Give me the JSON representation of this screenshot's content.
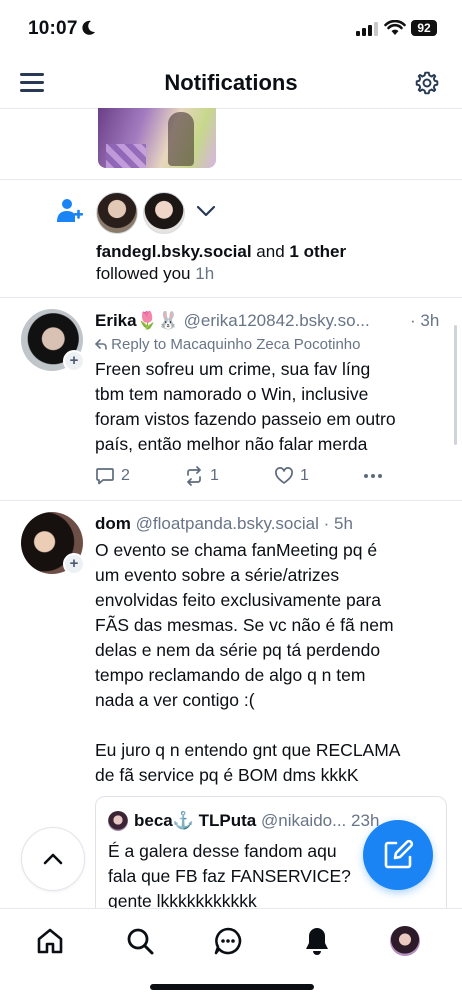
{
  "status_bar": {
    "time": "10:07",
    "battery": "92"
  },
  "header": {
    "title": "Notifications"
  },
  "follow_notification": {
    "handle": "fandegl.bsky.social",
    "connector": " and ",
    "others": "1 other",
    "action": "followed you",
    "time": "1h"
  },
  "posts": [
    {
      "display_name": "Erika🌷🐰",
      "handle": "@erika120842.bsky.so...",
      "time": "· 3h",
      "reply_to": "Reply to Macaquinho Zeca Pocotinho",
      "text": "Freen sofreu um crime, sua fav líng\ntbm tem namorado o Win, inclusive\nforam vistos fazendo passeio em outro\npaís, então melhor não falar merda",
      "reply_count": "2",
      "repost_count": "1",
      "like_count": "1"
    },
    {
      "display_name": "dom",
      "handle": "@floatpanda.bsky.social",
      "time": "· 5h",
      "text": "O evento se chama fanMeeting pq é\num evento sobre a série/atrizes\nenvolvidas feito exclusivamente para\nFÃS das mesmas. Se vc não é fã nem\ndelas e nem da série pq tá perdendo\ntempo reclamando de algo q n tem\nnada a ver contigo :(\n\nEu juro q n entendo gnt que RECLAMA\nde fã service pq é BOM dms kkkK"
    }
  ],
  "quoted_post": {
    "display_name": "beca⚓️ TLPuta",
    "handle": "@nikaido...",
    "time": "23h",
    "text": "É a galera desse fandom aqu\nfala que FB faz FANSERVICE?\ngente lkkkkkkkkkkk"
  },
  "icons": {
    "menu": "hamburger-menu-icon",
    "settings": "gear-icon",
    "follow": "person-plus-icon",
    "reply": "speech-bubble-icon",
    "repost": "repost-icon",
    "like": "heart-icon",
    "more": "ellipsis-icon",
    "scroll_top": "chevron-up-icon",
    "compose": "pencil-square-icon",
    "tabs": [
      "home-icon",
      "search-icon",
      "chat-icon",
      "bell-icon",
      "profile-avatar"
    ]
  },
  "colors": {
    "accent": "#1a84f4",
    "muted": "#687587",
    "text": "#0b0f14"
  }
}
